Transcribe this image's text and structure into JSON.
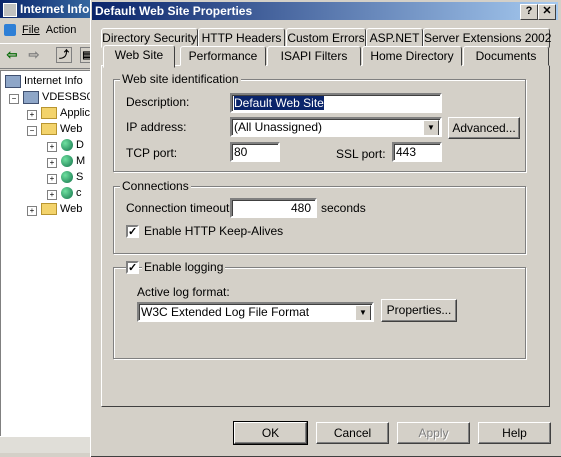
{
  "background_window": {
    "title": "Internet Info",
    "menu": [
      "File",
      "Action"
    ],
    "tree": [
      {
        "label": "Internet Info",
        "type": "computer"
      },
      {
        "label": "VDESBS0",
        "type": "computer"
      },
      {
        "label": "Applic",
        "type": "folder"
      },
      {
        "label": "Web",
        "type": "folder"
      },
      {
        "label": "D",
        "type": "globe"
      },
      {
        "label": "M",
        "type": "globe"
      },
      {
        "label": "S",
        "type": "globe"
      },
      {
        "label": "c",
        "type": "globe"
      },
      {
        "label": "Web",
        "type": "folder"
      }
    ]
  },
  "dialog": {
    "title": "Default Web Site Properties",
    "help_button": "?",
    "close_button": "✕",
    "tabs_back": [
      "Directory Security",
      "HTTP Headers",
      "Custom Errors",
      "ASP.NET",
      "Server Extensions 2002"
    ],
    "tabs_front": [
      "Web Site",
      "Performance",
      "ISAPI Filters",
      "Home Directory",
      "Documents"
    ],
    "active_tab": "Web Site",
    "identification": {
      "legend": "Web site identification",
      "description_label": "Description:",
      "description_value": "Default Web Site",
      "ip_label": "IP address:",
      "ip_value": "(All Unassigned)",
      "advanced_button": "Advanced...",
      "tcp_label": "TCP port:",
      "tcp_value": "80",
      "ssl_label": "SSL port:",
      "ssl_value": "443"
    },
    "connections": {
      "legend": "Connections",
      "timeout_label": "Connection timeout:",
      "timeout_value": "480",
      "timeout_unit": "seconds",
      "keepalive_label": "Enable HTTP Keep-Alives",
      "keepalive_checked": true
    },
    "logging": {
      "enable_label": "Enable logging",
      "enable_checked": true,
      "format_label": "Active log format:",
      "format_value": "W3C Extended Log File Format",
      "properties_button": "Properties..."
    },
    "buttons": {
      "ok": "OK",
      "cancel": "Cancel",
      "apply": "Apply",
      "help": "Help"
    }
  }
}
